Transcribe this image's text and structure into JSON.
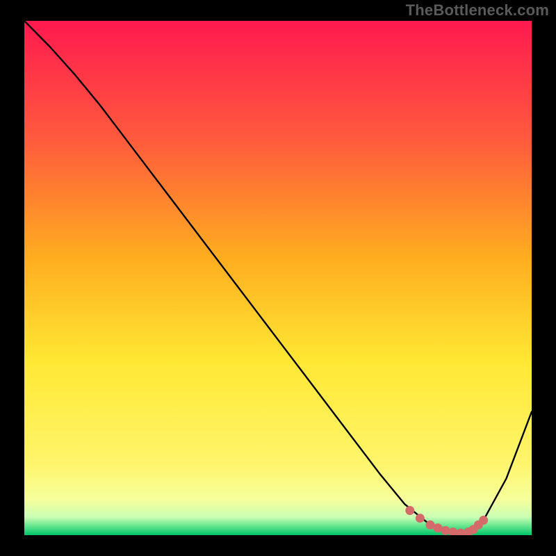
{
  "watermark": "TheBottleneck.com",
  "colors": {
    "frame_bg": "#000000",
    "watermark": "#5a5a5a",
    "gradient_top": "#ff1a4f",
    "gradient_mid_upper": "#ff6a3d",
    "gradient_mid": "#ffb000",
    "gradient_mid_lower": "#ffe733",
    "gradient_lower": "#fff56b",
    "gradient_green": "#00d36a",
    "curve": "#000000",
    "marker": "#d46a6a"
  },
  "chart_data": {
    "type": "line",
    "title": "",
    "xlabel": "",
    "ylabel": "",
    "xlim": [
      0,
      100
    ],
    "ylim": [
      0,
      100
    ],
    "series": [
      {
        "name": "bottleneck-curve",
        "x": [
          0,
          5,
          10,
          15,
          20,
          25,
          30,
          35,
          40,
          45,
          50,
          55,
          60,
          65,
          70,
          75,
          80,
          82,
          85,
          88,
          90,
          95,
          100
        ],
        "y": [
          100,
          95,
          89.5,
          83.5,
          77,
          70.5,
          64,
          57.5,
          51,
          44.5,
          38,
          31.5,
          25,
          18.5,
          12,
          6,
          2,
          1,
          0.3,
          0.5,
          2,
          11,
          24
        ]
      }
    ],
    "markers": {
      "name": "optimal-range",
      "x": [
        76,
        78,
        80,
        81.5,
        83,
        84.5,
        86,
        87.5,
        88.5,
        89.5,
        90.5
      ],
      "y": [
        4.8,
        3.3,
        2.0,
        1.4,
        0.9,
        0.6,
        0.4,
        0.6,
        1.1,
        2.0,
        2.9
      ]
    }
  }
}
